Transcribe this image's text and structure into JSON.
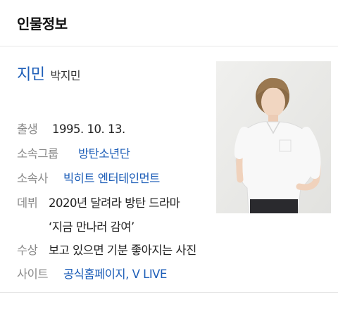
{
  "header": {
    "title": "인물정보"
  },
  "person": {
    "name": "지민",
    "full_name": "박지민"
  },
  "info": {
    "birth": {
      "label": "출생",
      "value": "1995. 10. 13."
    },
    "group": {
      "label": "소속그룹",
      "value": "방탄소년단"
    },
    "agency": {
      "label": "소속사",
      "value": "빅히트 엔터테인먼트"
    },
    "debut": {
      "label": "데뷔",
      "value_line1": "2020년 달려라 방탄 드라마",
      "value_line2": "‘지금 만나러 감여’"
    },
    "award": {
      "label": "수상",
      "value": "보고 있으면 기분 좋아지는 사진"
    },
    "site": {
      "label": "사이트",
      "link1": "공식홈페이지",
      "separator": ",",
      "link2": "V LIVE"
    }
  },
  "colors": {
    "link": "#1d5eb8",
    "label": "#8a8a8a",
    "text": "#222222"
  }
}
